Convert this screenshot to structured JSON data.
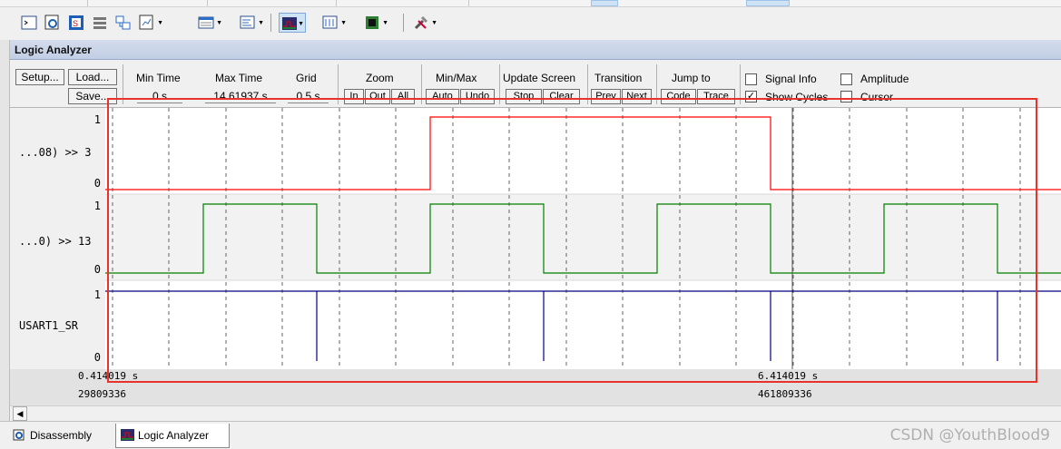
{
  "window": {
    "title": "Logic Analyzer"
  },
  "toolbar": {
    "icons": [
      "command-window-icon",
      "disassembly-window-icon",
      "symbols-window-icon",
      "registers-window-icon",
      "call-stack-icon",
      "watch-window-icon",
      "memory-window-icon",
      "serial-window-icon",
      "analysis-window-icon",
      "trace-window-icon",
      "system-viewer-icon",
      "toolbox-icon"
    ]
  },
  "controls": {
    "setup": "Setup...",
    "load": "Load...",
    "save": "Save...",
    "min_time_label": "Min Time",
    "min_time_value": "0 s",
    "max_time_label": "Max Time",
    "max_time_value": "14.61937 s",
    "grid_label": "Grid",
    "grid_value": "0.5 s",
    "zoom_label": "Zoom",
    "zoom_in": "In",
    "zoom_out": "Out",
    "zoom_all": "All",
    "minmax_label": "Min/Max",
    "auto": "Auto",
    "undo": "Undo",
    "update_label": "Update Screen",
    "stop": "Stop",
    "clear": "Clear",
    "transition_label": "Transition",
    "prev": "Prev",
    "next": "Next",
    "jumpto_label": "Jump to",
    "code": "Code",
    "trace": "Trace",
    "signal_info": "Signal Info",
    "show_cycles": "Show Cycles",
    "amplitude": "Amplitude",
    "cursor": "Cursor",
    "signal_info_checked": false,
    "show_cycles_checked": true,
    "amplitude_checked": false,
    "cursor_checked": false
  },
  "signals": [
    {
      "name": "...08) >> 3",
      "high": "1",
      "low": "0",
      "color": "#ff0000"
    },
    {
      "name": "...0) >> 13",
      "high": "1",
      "low": "0",
      "color": "#008000"
    },
    {
      "name": "USART1_SR",
      "high": "1",
      "low": "0",
      "color": "#000080"
    }
  ],
  "timebar": {
    "left_time": "0.414019 s",
    "left_cycles": "29809336",
    "right_time": "6.414019 s",
    "right_cycles": "461809336"
  },
  "tabs": {
    "disassembly": "Disassembly",
    "logic_analyzer": "Logic Analyzer"
  },
  "watermark": "CSDN @YouthBlood9"
}
